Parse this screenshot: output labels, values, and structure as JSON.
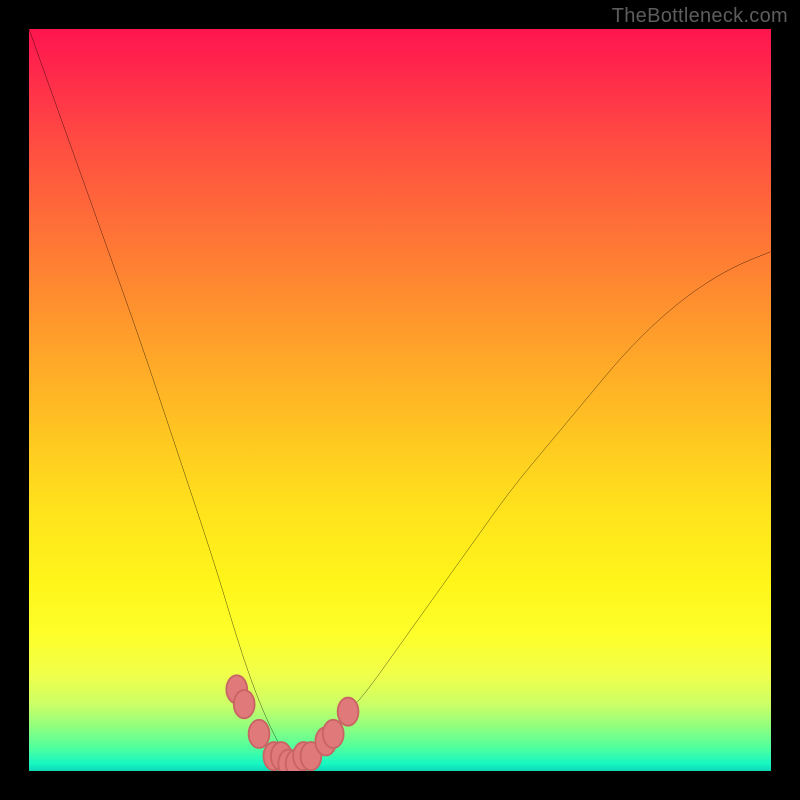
{
  "watermark": {
    "text": "TheBottleneck.com"
  },
  "palette": {
    "frame": "#000000",
    "curve": "#000000",
    "marker_fill": "#e07a7a",
    "marker_stroke": "#c96464",
    "gradient_top": "#ff154f",
    "gradient_bottom": "#0cd9b6"
  },
  "chart_data": {
    "type": "line",
    "title": "",
    "xlabel": "",
    "ylabel": "",
    "xlim": [
      0,
      100
    ],
    "ylim": [
      0,
      100
    ],
    "grid": false,
    "legend": false,
    "description": "Bottleneck-style V-curve. x ≈ component balance (%). y ≈ bottleneck severity (%). Minimum (best, green) near x≈35; rises steeply toward both extremes (red).",
    "series": [
      {
        "name": "bottleneck-curve",
        "x": [
          0,
          5,
          10,
          15,
          20,
          25,
          28,
          30,
          32,
          34,
          35,
          36,
          38,
          40,
          42,
          45,
          50,
          55,
          60,
          65,
          70,
          75,
          80,
          85,
          90,
          95,
          100
        ],
        "values": [
          100,
          86,
          72,
          58,
          43,
          28,
          18,
          12,
          7,
          3,
          2,
          2,
          3,
          5,
          7,
          10,
          17,
          24,
          31,
          38,
          44,
          50,
          56,
          61,
          65,
          68,
          70
        ]
      }
    ],
    "markers": {
      "name": "trough-markers",
      "x": [
        28,
        29,
        31,
        33,
        34,
        35,
        36,
        37,
        38,
        40,
        41,
        43
      ],
      "values": [
        11,
        9,
        5,
        2,
        2,
        1,
        1,
        2,
        2,
        4,
        5,
        8
      ],
      "rx": 1.4,
      "ry": 1.9
    },
    "background_gradient_stops": [
      {
        "pct": 0,
        "color": "#ff154f"
      },
      {
        "pct": 7,
        "color": "#ff2d4a"
      },
      {
        "pct": 15,
        "color": "#ff4b42"
      },
      {
        "pct": 25,
        "color": "#ff6b39"
      },
      {
        "pct": 35,
        "color": "#ff8a30"
      },
      {
        "pct": 45,
        "color": "#ffa928"
      },
      {
        "pct": 55,
        "color": "#ffc721"
      },
      {
        "pct": 65,
        "color": "#ffe31c"
      },
      {
        "pct": 75,
        "color": "#fff61a"
      },
      {
        "pct": 82,
        "color": "#fdff2c"
      },
      {
        "pct": 87,
        "color": "#f0ff4a"
      },
      {
        "pct": 91,
        "color": "#ccff66"
      },
      {
        "pct": 94,
        "color": "#90ff7e"
      },
      {
        "pct": 97,
        "color": "#4dffa0"
      },
      {
        "pct": 99,
        "color": "#17f7c2"
      },
      {
        "pct": 100,
        "color": "#0cd9b6"
      }
    ]
  }
}
